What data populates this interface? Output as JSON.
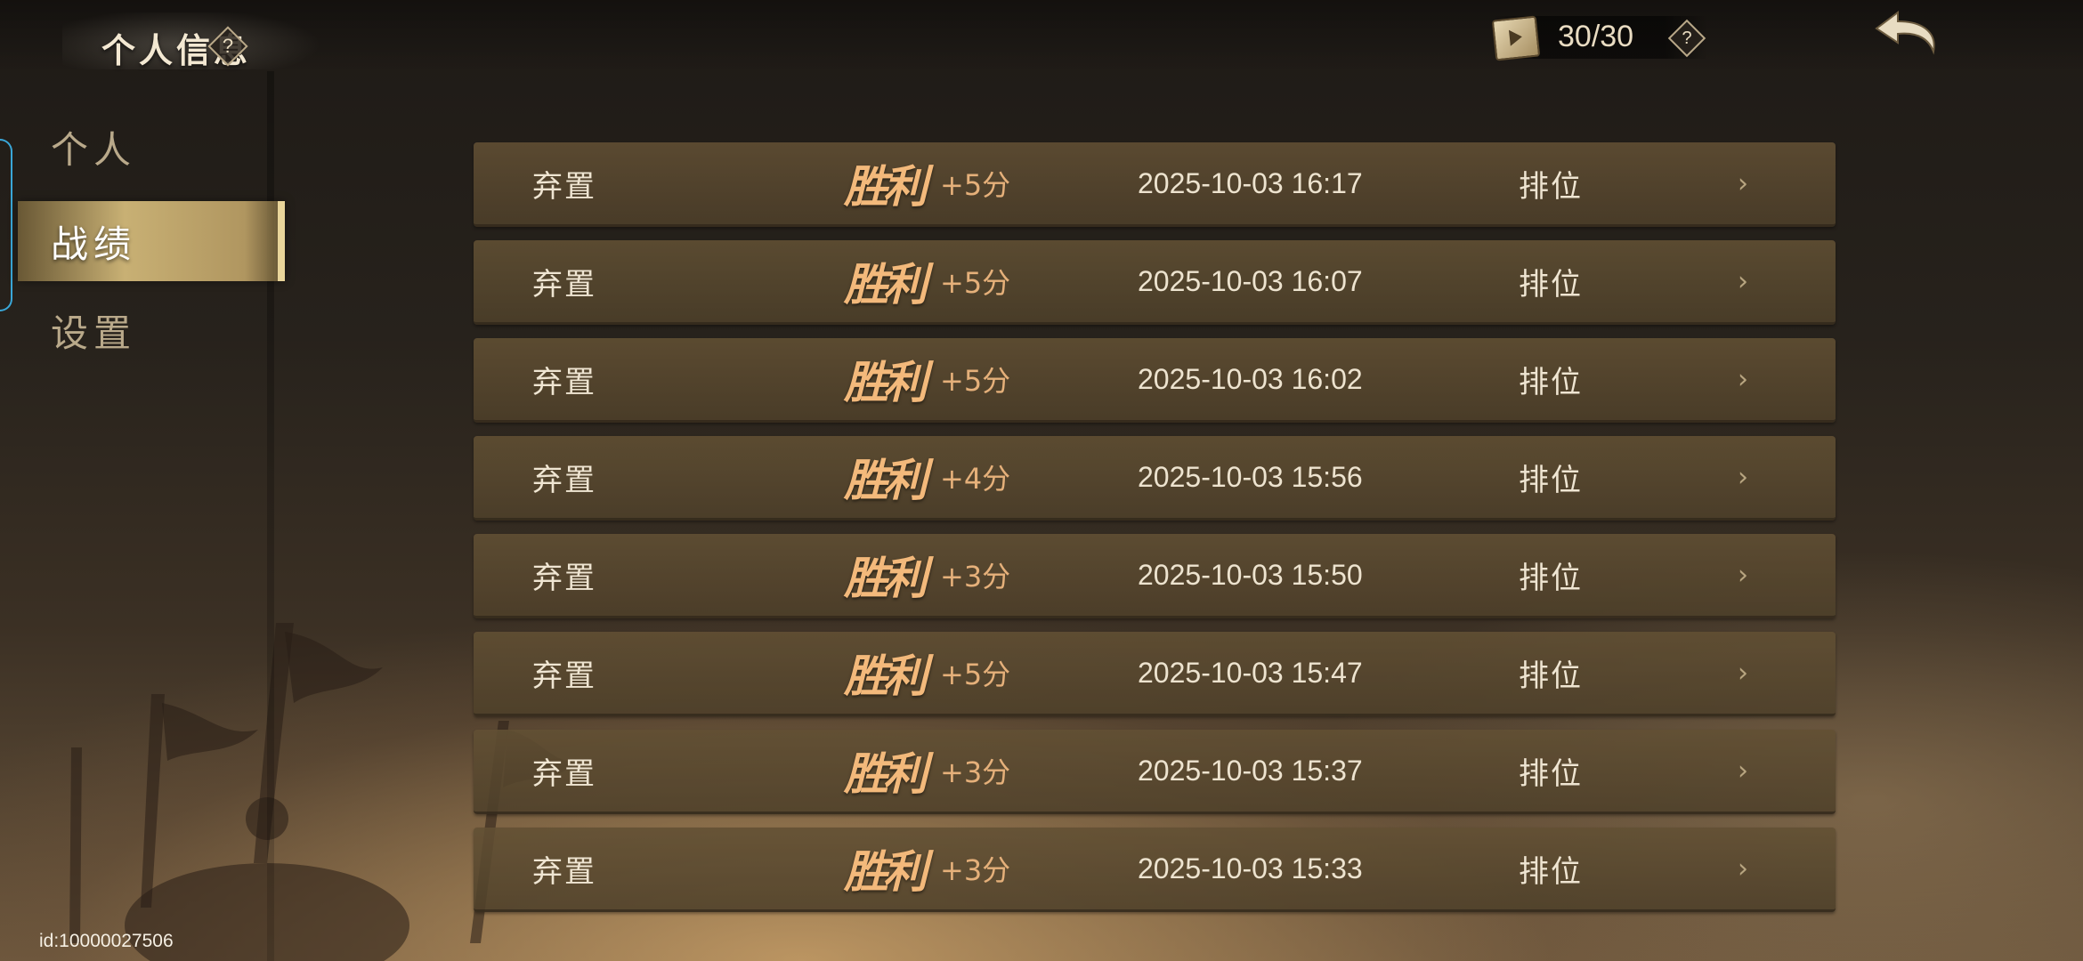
{
  "header": {
    "title": "个人信息",
    "title_help": "?",
    "ticket_count": "30/30",
    "ticket_help": "?",
    "back_icon": "back-arrow-icon"
  },
  "sidebar": {
    "items": [
      {
        "label": "个人",
        "active": false
      },
      {
        "label": "战绩",
        "active": true
      },
      {
        "label": "设置",
        "active": false
      }
    ]
  },
  "records": {
    "columns": [
      "mode",
      "result",
      "score",
      "time",
      "type"
    ],
    "rows": [
      {
        "mode": "弃置",
        "result": "胜利",
        "score": "+5分",
        "time": "2025-10-03 16:17",
        "type": "排位",
        "arrow": "›"
      },
      {
        "mode": "弃置",
        "result": "胜利",
        "score": "+5分",
        "time": "2025-10-03 16:07",
        "type": "排位",
        "arrow": "›"
      },
      {
        "mode": "弃置",
        "result": "胜利",
        "score": "+5分",
        "time": "2025-10-03 16:02",
        "type": "排位",
        "arrow": "›"
      },
      {
        "mode": "弃置",
        "result": "胜利",
        "score": "+4分",
        "time": "2025-10-03 15:56",
        "type": "排位",
        "arrow": "›"
      },
      {
        "mode": "弃置",
        "result": "胜利",
        "score": "+3分",
        "time": "2025-10-03 15:50",
        "type": "排位",
        "arrow": "›"
      },
      {
        "mode": "弃置",
        "result": "胜利",
        "score": "+5分",
        "time": "2025-10-03 15:47",
        "type": "排位",
        "arrow": "›"
      },
      {
        "mode": "弃置",
        "result": "胜利",
        "score": "+3分",
        "time": "2025-10-03 15:37",
        "type": "排位",
        "arrow": "›"
      },
      {
        "mode": "弃置",
        "result": "胜利",
        "score": "+3分",
        "time": "2025-10-03 15:33",
        "type": "排位",
        "arrow": "›"
      }
    ]
  },
  "footer": {
    "user_id": "id:10000027506"
  },
  "colors": {
    "accent_gold": "#c8b074",
    "victory": "#f3b97b",
    "score": "#e5b07a",
    "row_bg": "#5a4a32"
  }
}
